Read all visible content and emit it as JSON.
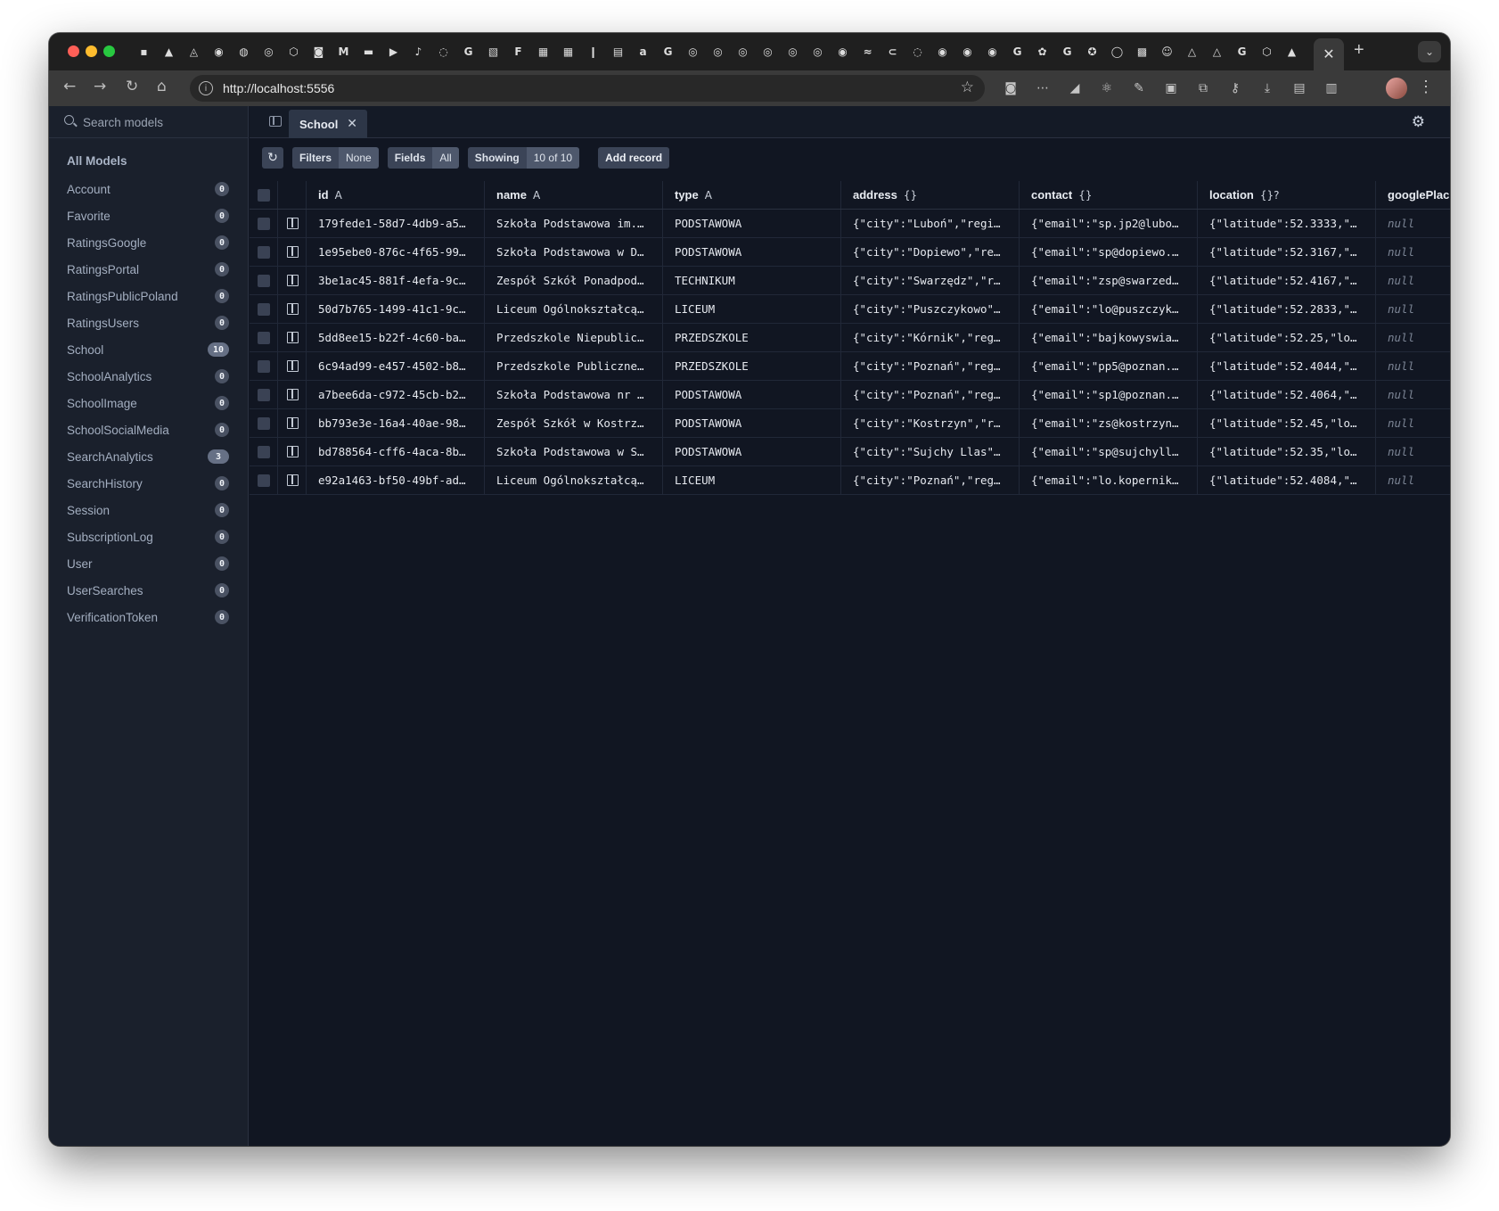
{
  "browser": {
    "url": "http://localhost:5556",
    "pinned_tab_glyphs": [
      "▪",
      "▲",
      "◬",
      "◉",
      "◍",
      "◎",
      "⬡",
      "◙",
      "M",
      "▬",
      "▶",
      "♪",
      "◌",
      "G",
      "▧",
      "F",
      "▦",
      "▦",
      "❙",
      "▤",
      "a",
      "G",
      "◎",
      "◎",
      "◎",
      "◎",
      "◎",
      "◎",
      "◉",
      "≈",
      "⊂",
      "◌",
      "◉",
      "◉",
      "◉",
      "G",
      "✿",
      "G",
      "✪",
      "◯",
      "▩",
      "☺",
      "△",
      "△",
      "G",
      "⬡",
      "▲"
    ],
    "active_tab_close": "✕",
    "new_tab": "+",
    "tab_menu": "⌄",
    "nav": {
      "back": "←",
      "forward": "→",
      "reload": "↻",
      "home": "⌂"
    },
    "star": "☆",
    "ext_glyphs": [
      "◙",
      "⋯",
      "◢",
      "⚛",
      "✎",
      "▣",
      "⧉",
      "⚷",
      "⤓",
      "▤",
      "▥"
    ],
    "menu": "⋮"
  },
  "sidebar": {
    "search_placeholder": "Search models",
    "title": "All Models",
    "models": [
      {
        "label": "Account",
        "count": "0"
      },
      {
        "label": "Favorite",
        "count": "0"
      },
      {
        "label": "RatingsGoogle",
        "count": "0"
      },
      {
        "label": "RatingsPortal",
        "count": "0"
      },
      {
        "label": "RatingsPublicPoland",
        "count": "0"
      },
      {
        "label": "RatingsUsers",
        "count": "0"
      },
      {
        "label": "School",
        "count": "10"
      },
      {
        "label": "SchoolAnalytics",
        "count": "0"
      },
      {
        "label": "SchoolImage",
        "count": "0"
      },
      {
        "label": "SchoolSocialMedia",
        "count": "0"
      },
      {
        "label": "SearchAnalytics",
        "count": "3"
      },
      {
        "label": "SearchHistory",
        "count": "0"
      },
      {
        "label": "Session",
        "count": "0"
      },
      {
        "label": "SubscriptionLog",
        "count": "0"
      },
      {
        "label": "User",
        "count": "0"
      },
      {
        "label": "UserSearches",
        "count": "0"
      },
      {
        "label": "VerificationToken",
        "count": "0"
      }
    ]
  },
  "main": {
    "tab_label": "School",
    "tab_close": "✕",
    "settings_icon": "⚙",
    "refresh_icon": "↻",
    "filters": {
      "label": "Filters",
      "value": "None"
    },
    "fields": {
      "label": "Fields",
      "value": "All"
    },
    "showing": {
      "label": "Showing",
      "value": "10 of 10"
    },
    "add_record": "Add record"
  },
  "table": {
    "columns": [
      {
        "name": "id",
        "type": "A"
      },
      {
        "name": "name",
        "type": "A"
      },
      {
        "name": "type",
        "type": "A"
      },
      {
        "name": "address",
        "type": "{}"
      },
      {
        "name": "contact",
        "type": "{}"
      },
      {
        "name": "location",
        "type": "{}?"
      },
      {
        "name": "googlePlac",
        "type": ""
      }
    ],
    "rows": [
      [
        "179fede1-58d7-4db9-a5…",
        "Szkoła Podstawowa im.…",
        "PODSTAWOWA",
        "{\"city\":\"Luboń\",\"regi…",
        "{\"email\":\"sp.jp2@lubo…",
        "{\"latitude\":52.3333,\"…",
        "null"
      ],
      [
        "1e95ebe0-876c-4f65-99…",
        "Szkoła Podstawowa w D…",
        "PODSTAWOWA",
        "{\"city\":\"Dopiewo\",\"re…",
        "{\"email\":\"sp@dopiewo.…",
        "{\"latitude\":52.3167,\"…",
        "null"
      ],
      [
        "3be1ac45-881f-4efa-9c…",
        "Zespół Szkół Ponadpod…",
        "TECHNIKUM",
        "{\"city\":\"Swarzędz\",\"r…",
        "{\"email\":\"zsp@swarzed…",
        "{\"latitude\":52.4167,\"…",
        "null"
      ],
      [
        "50d7b765-1499-41c1-9c…",
        "Liceum Ogólnokształcą…",
        "LICEUM",
        "{\"city\":\"Puszczykowo\"…",
        "{\"email\":\"lo@puszczyk…",
        "{\"latitude\":52.2833,\"…",
        "null"
      ],
      [
        "5dd8ee15-b22f-4c60-ba…",
        "Przedszkole Niepublic…",
        "PRZEDSZKOLE",
        "{\"city\":\"Kórnik\",\"reg…",
        "{\"email\":\"bajkowyswia…",
        "{\"latitude\":52.25,\"lo…",
        "null"
      ],
      [
        "6c94ad99-e457-4502-b8…",
        "Przedszkole Publiczne…",
        "PRZEDSZKOLE",
        "{\"city\":\"Poznań\",\"reg…",
        "{\"email\":\"pp5@poznan.…",
        "{\"latitude\":52.4044,\"…",
        "null"
      ],
      [
        "a7bee6da-c972-45cb-b2…",
        "Szkoła Podstawowa nr …",
        "PODSTAWOWA",
        "{\"city\":\"Poznań\",\"reg…",
        "{\"email\":\"sp1@poznan.…",
        "{\"latitude\":52.4064,\"…",
        "null"
      ],
      [
        "bb793e3e-16a4-40ae-98…",
        "Zespół Szkół w Kostrz…",
        "PODSTAWOWA",
        "{\"city\":\"Kostrzyn\",\"r…",
        "{\"email\":\"zs@kostrzyn…",
        "{\"latitude\":52.45,\"lo…",
        "null"
      ],
      [
        "bd788564-cff6-4aca-8b…",
        "Szkoła Podstawowa w S…",
        "PODSTAWOWA",
        "{\"city\":\"Sujchy Llas\"…",
        "{\"email\":\"sp@sujchyll…",
        "{\"latitude\":52.35,\"lo…",
        "null"
      ],
      [
        "e92a1463-bf50-49bf-ad…",
        "Liceum Ogólnokształcą…",
        "LICEUM",
        "{\"city\":\"Poznań\",\"reg…",
        "{\"email\":\"lo.kopernik…",
        "{\"latitude\":52.4084,\"…",
        "null"
      ]
    ]
  }
}
